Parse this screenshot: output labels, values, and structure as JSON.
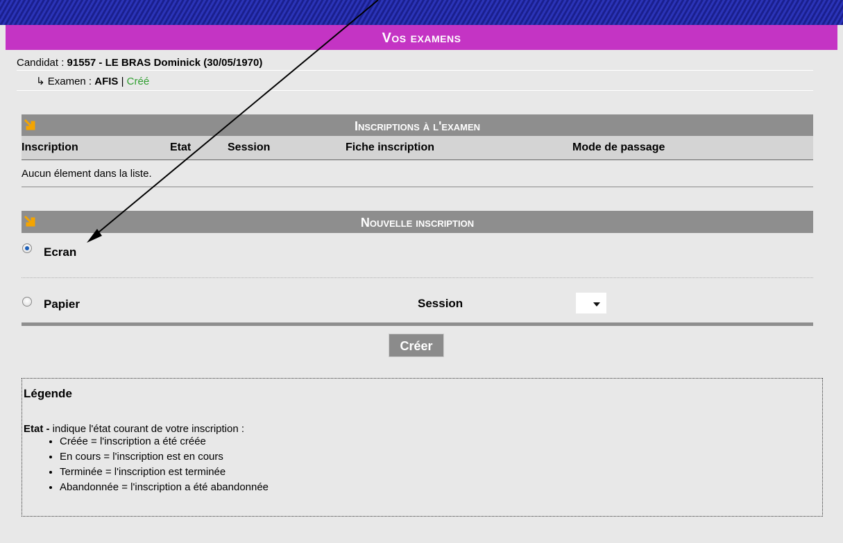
{
  "header": {
    "title": "Vos examens"
  },
  "candidate": {
    "label": "Candidat : ",
    "value": "91557 - LE BRAS Dominick (30/05/1970)"
  },
  "exam": {
    "prefix": "↳ Examen : ",
    "name": "AFIS",
    "separator": " | ",
    "status": "Créé"
  },
  "registrations": {
    "title": "Inscriptions à l'examen",
    "columns": [
      "Inscription",
      "Etat",
      "Session",
      "Fiche inscription",
      "Mode de passage"
    ],
    "empty_text": "Aucun élement dans la liste."
  },
  "new_registration": {
    "title": "Nouvelle inscription",
    "options": [
      {
        "label": "Ecran",
        "checked": true
      },
      {
        "label": "Papier",
        "checked": false
      }
    ],
    "session_label": "Session",
    "session_value": "",
    "create_label": "Créer"
  },
  "legend": {
    "title": "Légende",
    "etat_label": "Etat -",
    "etat_text": " indique l'état courant de votre inscription :",
    "items": [
      "Créée = l'inscription a été créée",
      "En cours = l'inscription est en cours",
      "Terminée = l'inscription est terminée",
      "Abandonnée = l'inscription a été abandonnée"
    ]
  },
  "colors": {
    "title_bar": "#c434c4",
    "section_bar": "#8e8e8e",
    "status_green": "#2e9e2e",
    "radio_selected": "#1c5fb8"
  }
}
